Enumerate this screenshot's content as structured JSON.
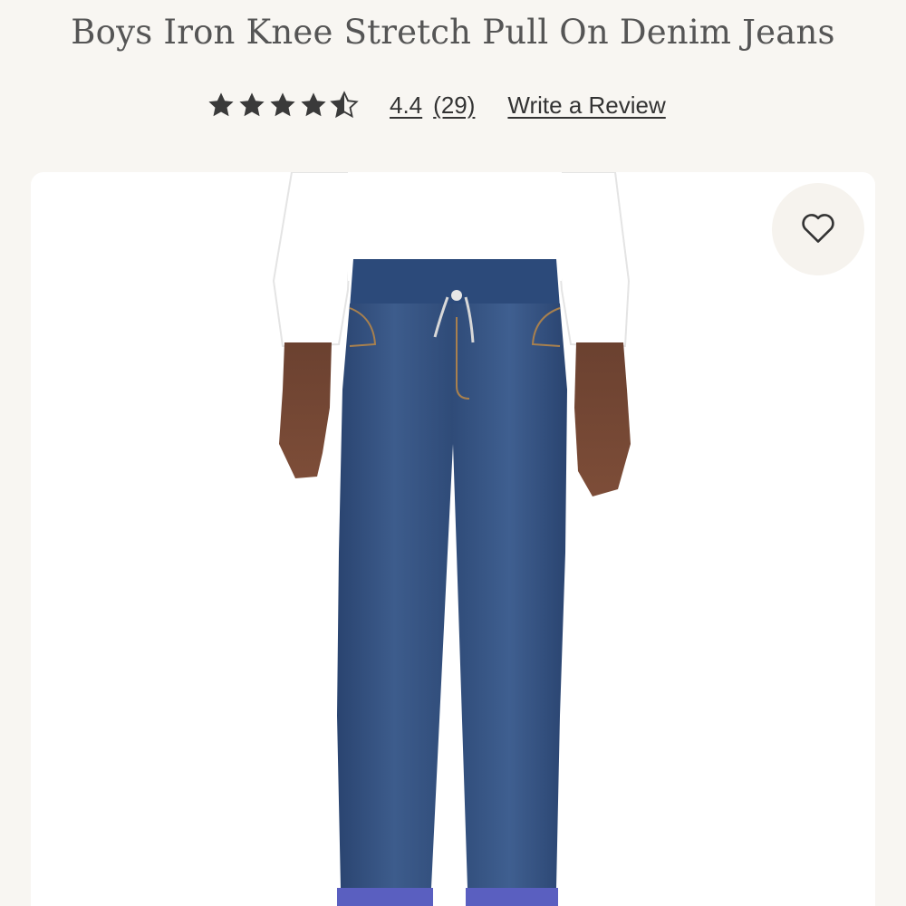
{
  "product": {
    "title": "Boys Iron Knee Stretch Pull On Denim Jeans",
    "rating": {
      "value": "4.4",
      "count": "(29)",
      "stars": 4.4,
      "max_stars": 5,
      "write_review_label": "Write a Review"
    }
  },
  "icons": {
    "rating": "star-icon",
    "wishlist": "heart-icon"
  },
  "colors": {
    "page_background": "#f8f6f2",
    "star_fill": "#3a3a3a",
    "text": "#333333",
    "denim": "#34527f",
    "shirt": "#ffffff"
  }
}
